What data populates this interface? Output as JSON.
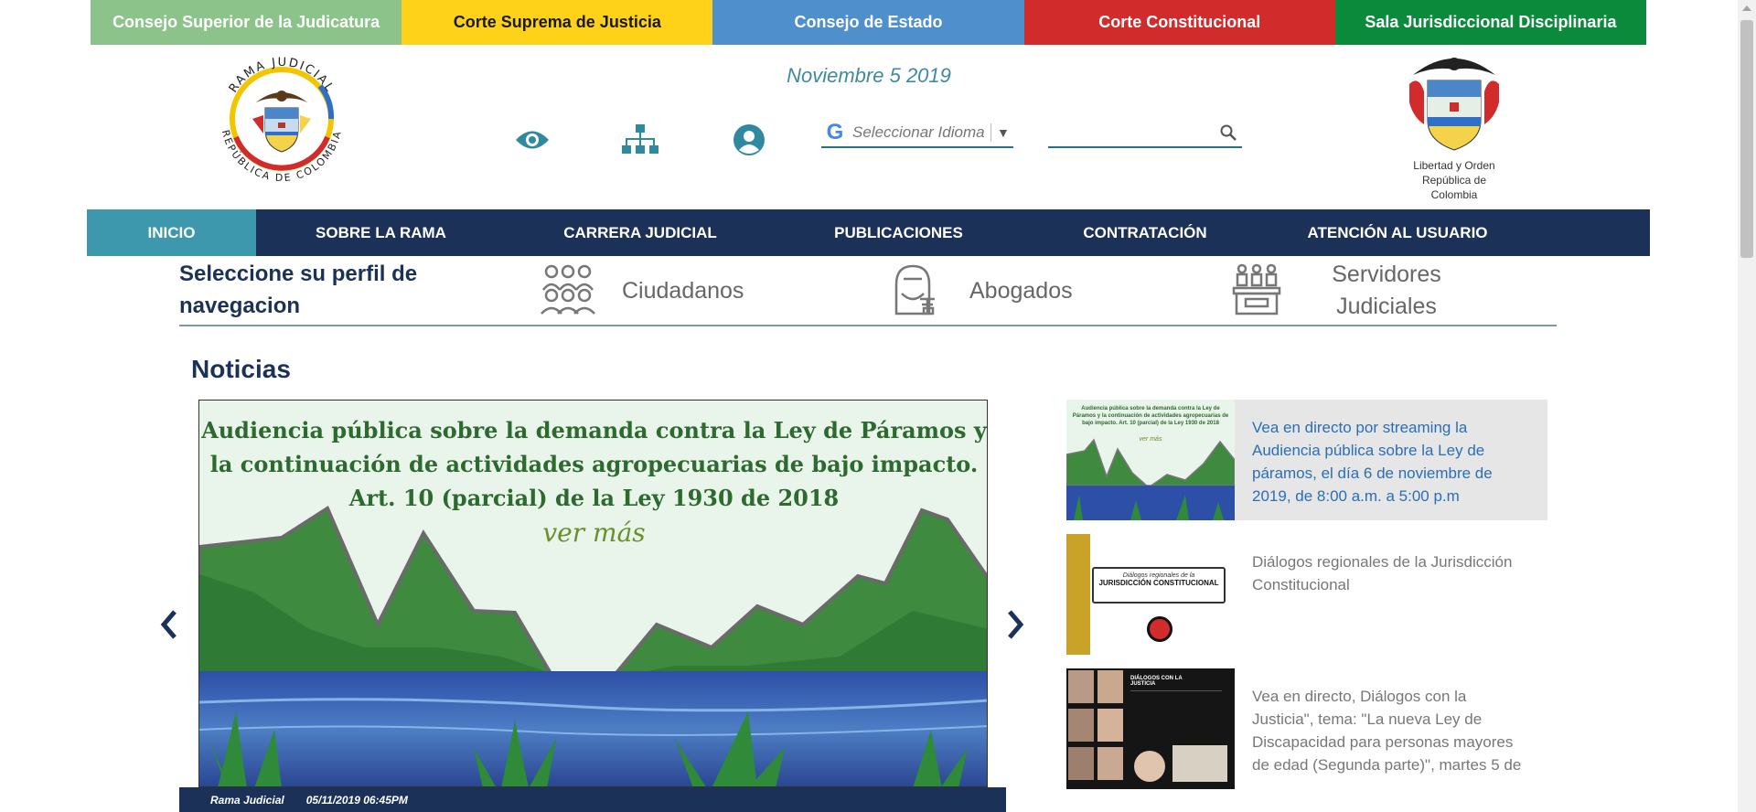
{
  "top_bar": [
    {
      "label": "Consejo Superior de la Judicatura",
      "bg": "#8cc38b",
      "fg": "#ffffff"
    },
    {
      "label": "Corte Suprema de Justicia",
      "bg": "#fdd219",
      "fg": "#1a1a1a"
    },
    {
      "label": "Consejo de Estado",
      "bg": "#4f8fcc",
      "fg": "#ffffff"
    },
    {
      "label": "Corte Constitucional",
      "bg": "#d22b2b",
      "fg": "#ffffff"
    },
    {
      "label": "Sala Jurisdiccional Disciplinaria",
      "bg": "#0c8a3c",
      "fg": "#ffffff"
    }
  ],
  "header": {
    "date": "Noviembre 5 2019",
    "logo_left_text": "RAMA JUDICIAL · REPÚBLICA DE COLOMBIA",
    "logo_right_line1": "Libertad y Orden",
    "logo_right_line2": "República de Colombia",
    "language_g": "G",
    "language_placeholder": "Seleccionar Idioma",
    "language_arrow": "▼",
    "search_placeholder": ""
  },
  "icons": {
    "accessibility": "eye-icon",
    "sitemap": "sitemap-icon",
    "user": "user-icon",
    "search": "search-icon"
  },
  "nav": [
    {
      "label": "INICIO",
      "active": true
    },
    {
      "label": "SOBRE LA RAMA",
      "active": false
    },
    {
      "label": "CARRERA JUDICIAL",
      "active": false
    },
    {
      "label": "PUBLICACIONES",
      "active": false
    },
    {
      "label": "CONTRATACIÓN",
      "active": false
    },
    {
      "label": "ATENCIÓN AL USUARIO",
      "active": false
    }
  ],
  "profile": {
    "title": "Seleccione su perfil de navegacion",
    "options": [
      {
        "label": "Ciudadanos",
        "icon": "citizens-icon"
      },
      {
        "label": "Abogados",
        "icon": "lawyer-icon"
      },
      {
        "label": "Servidores Judiciales",
        "icon": "judicial-servers-icon"
      }
    ]
  },
  "news": {
    "title": "Noticias",
    "slide": {
      "headline": "Audiencia pública sobre la demanda contra la Ley de Páramos y la continuación de actividades agropecuarias de bajo impacto. Art. 10 (parcial) de la Ley 1930 de 2018",
      "more": "ver más",
      "source": "Rama Judicial",
      "datetime": "05/11/2019 06:45PM"
    },
    "items": [
      {
        "text": "Vea en directo por streaming la Audiencia pública sobre la Ley de páramos, el día 6 de noviembre de 2019, de 8:00 a.m. a 5:00 p.m",
        "active": true,
        "thumb_caption": "Audiencia pública sobre la demanda contra la Ley de Páramos y la continuación de actividades agropecuarias de bajo impacto. Art. 10 (parcial) de la Ley 1930 de 2018",
        "thumb_more": "ver más"
      },
      {
        "text": "Diálogos regionales de la Jurisdicción Constitucional",
        "active": false,
        "thumb_caption": "Diálogos regionales de la",
        "thumb_caption2": "JURISDICCIÓN CONSTITUCIONAL"
      },
      {
        "text": "Vea en directo, Diálogos con la Justicia\", tema: \"La nueva Ley de Discapacidad para personas mayores de edad (Segunda parte)\", martes 5 de",
        "active": false,
        "thumb_caption": "DIÁLOGOS CON LA JUSTICIA"
      }
    ]
  },
  "colors": {
    "navy": "#1b3158",
    "nav_active": "#3d97ad",
    "teal": "#2f8aa0"
  }
}
